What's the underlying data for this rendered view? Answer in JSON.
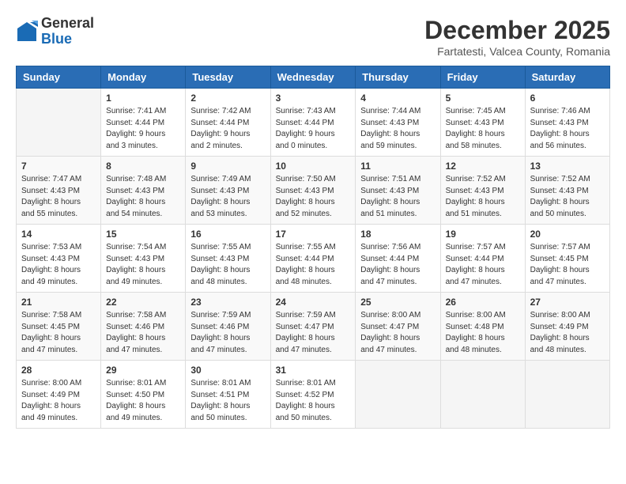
{
  "header": {
    "logo": {
      "general": "General",
      "blue": "Blue"
    },
    "title": "December 2025",
    "location": "Fartatesti, Valcea County, Romania"
  },
  "calendar": {
    "days_of_week": [
      "Sunday",
      "Monday",
      "Tuesday",
      "Wednesday",
      "Thursday",
      "Friday",
      "Saturday"
    ],
    "weeks": [
      [
        {
          "day": "",
          "info": ""
        },
        {
          "day": "1",
          "info": "Sunrise: 7:41 AM\nSunset: 4:44 PM\nDaylight: 9 hours\nand 3 minutes."
        },
        {
          "day": "2",
          "info": "Sunrise: 7:42 AM\nSunset: 4:44 PM\nDaylight: 9 hours\nand 2 minutes."
        },
        {
          "day": "3",
          "info": "Sunrise: 7:43 AM\nSunset: 4:44 PM\nDaylight: 9 hours\nand 0 minutes."
        },
        {
          "day": "4",
          "info": "Sunrise: 7:44 AM\nSunset: 4:43 PM\nDaylight: 8 hours\nand 59 minutes."
        },
        {
          "day": "5",
          "info": "Sunrise: 7:45 AM\nSunset: 4:43 PM\nDaylight: 8 hours\nand 58 minutes."
        },
        {
          "day": "6",
          "info": "Sunrise: 7:46 AM\nSunset: 4:43 PM\nDaylight: 8 hours\nand 56 minutes."
        }
      ],
      [
        {
          "day": "7",
          "info": "Sunrise: 7:47 AM\nSunset: 4:43 PM\nDaylight: 8 hours\nand 55 minutes."
        },
        {
          "day": "8",
          "info": "Sunrise: 7:48 AM\nSunset: 4:43 PM\nDaylight: 8 hours\nand 54 minutes."
        },
        {
          "day": "9",
          "info": "Sunrise: 7:49 AM\nSunset: 4:43 PM\nDaylight: 8 hours\nand 53 minutes."
        },
        {
          "day": "10",
          "info": "Sunrise: 7:50 AM\nSunset: 4:43 PM\nDaylight: 8 hours\nand 52 minutes."
        },
        {
          "day": "11",
          "info": "Sunrise: 7:51 AM\nSunset: 4:43 PM\nDaylight: 8 hours\nand 51 minutes."
        },
        {
          "day": "12",
          "info": "Sunrise: 7:52 AM\nSunset: 4:43 PM\nDaylight: 8 hours\nand 51 minutes."
        },
        {
          "day": "13",
          "info": "Sunrise: 7:52 AM\nSunset: 4:43 PM\nDaylight: 8 hours\nand 50 minutes."
        }
      ],
      [
        {
          "day": "14",
          "info": "Sunrise: 7:53 AM\nSunset: 4:43 PM\nDaylight: 8 hours\nand 49 minutes."
        },
        {
          "day": "15",
          "info": "Sunrise: 7:54 AM\nSunset: 4:43 PM\nDaylight: 8 hours\nand 49 minutes."
        },
        {
          "day": "16",
          "info": "Sunrise: 7:55 AM\nSunset: 4:43 PM\nDaylight: 8 hours\nand 48 minutes."
        },
        {
          "day": "17",
          "info": "Sunrise: 7:55 AM\nSunset: 4:44 PM\nDaylight: 8 hours\nand 48 minutes."
        },
        {
          "day": "18",
          "info": "Sunrise: 7:56 AM\nSunset: 4:44 PM\nDaylight: 8 hours\nand 47 minutes."
        },
        {
          "day": "19",
          "info": "Sunrise: 7:57 AM\nSunset: 4:44 PM\nDaylight: 8 hours\nand 47 minutes."
        },
        {
          "day": "20",
          "info": "Sunrise: 7:57 AM\nSunset: 4:45 PM\nDaylight: 8 hours\nand 47 minutes."
        }
      ],
      [
        {
          "day": "21",
          "info": "Sunrise: 7:58 AM\nSunset: 4:45 PM\nDaylight: 8 hours\nand 47 minutes."
        },
        {
          "day": "22",
          "info": "Sunrise: 7:58 AM\nSunset: 4:46 PM\nDaylight: 8 hours\nand 47 minutes."
        },
        {
          "day": "23",
          "info": "Sunrise: 7:59 AM\nSunset: 4:46 PM\nDaylight: 8 hours\nand 47 minutes."
        },
        {
          "day": "24",
          "info": "Sunrise: 7:59 AM\nSunset: 4:47 PM\nDaylight: 8 hours\nand 47 minutes."
        },
        {
          "day": "25",
          "info": "Sunrise: 8:00 AM\nSunset: 4:47 PM\nDaylight: 8 hours\nand 47 minutes."
        },
        {
          "day": "26",
          "info": "Sunrise: 8:00 AM\nSunset: 4:48 PM\nDaylight: 8 hours\nand 48 minutes."
        },
        {
          "day": "27",
          "info": "Sunrise: 8:00 AM\nSunset: 4:49 PM\nDaylight: 8 hours\nand 48 minutes."
        }
      ],
      [
        {
          "day": "28",
          "info": "Sunrise: 8:00 AM\nSunset: 4:49 PM\nDaylight: 8 hours\nand 49 minutes."
        },
        {
          "day": "29",
          "info": "Sunrise: 8:01 AM\nSunset: 4:50 PM\nDaylight: 8 hours\nand 49 minutes."
        },
        {
          "day": "30",
          "info": "Sunrise: 8:01 AM\nSunset: 4:51 PM\nDaylight: 8 hours\nand 50 minutes."
        },
        {
          "day": "31",
          "info": "Sunrise: 8:01 AM\nSunset: 4:52 PM\nDaylight: 8 hours\nand 50 minutes."
        },
        {
          "day": "",
          "info": ""
        },
        {
          "day": "",
          "info": ""
        },
        {
          "day": "",
          "info": ""
        }
      ]
    ]
  }
}
